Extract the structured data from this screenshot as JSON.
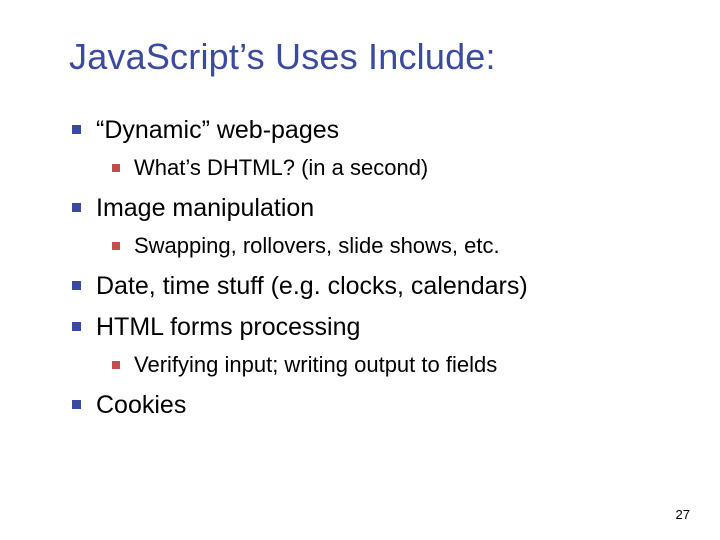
{
  "title": "JavaScript’s Uses Include:",
  "bullets": [
    {
      "text": "“Dynamic” web-pages",
      "children": [
        "What’s DHTML? (in a second)"
      ]
    },
    {
      "text": "Image manipulation",
      "children": [
        "Swapping, rollovers, slide shows, etc."
      ]
    },
    {
      "text": "Date, time stuff (e.g. clocks, calendars)",
      "children": []
    },
    {
      "text": "HTML forms processing",
      "children": [
        "Verifying input; writing output to fields"
      ]
    },
    {
      "text": "Cookies",
      "children": []
    }
  ],
  "page_number": "27"
}
